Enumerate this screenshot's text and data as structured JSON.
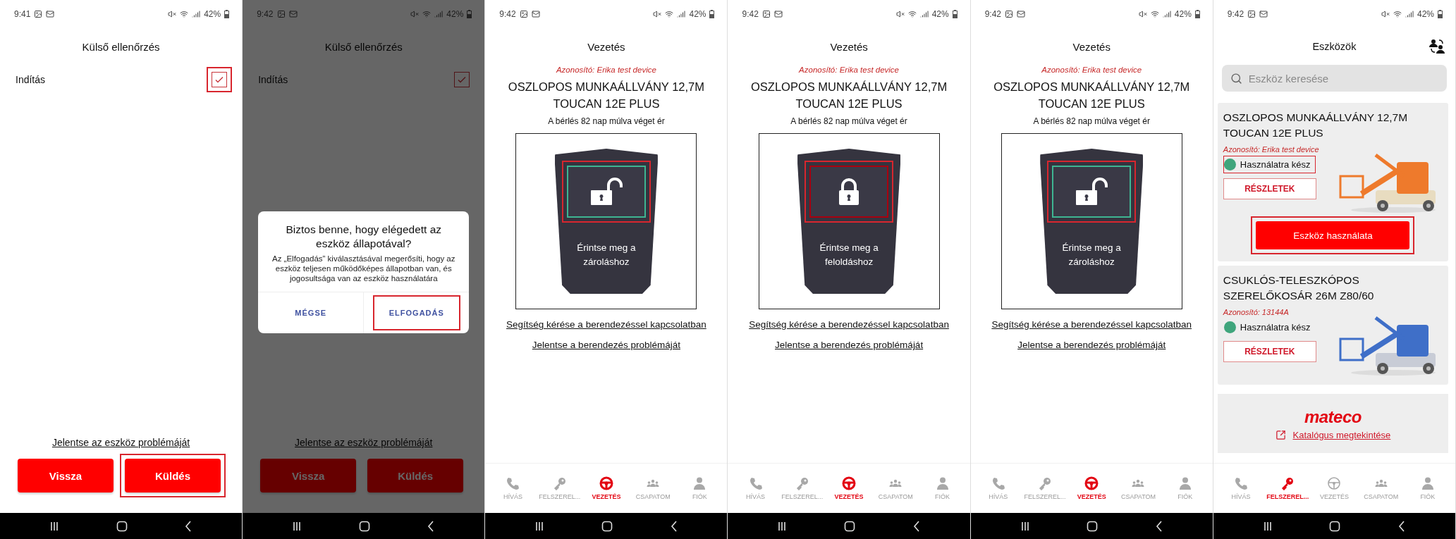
{
  "screens": [
    {
      "kind": "checklist",
      "time": "9:41",
      "battery": "42%",
      "dimmed": false,
      "title": "Külső ellenőrzés",
      "items": [
        {
          "label": "Indítás",
          "checked": true,
          "highlighted": true
        }
      ],
      "report_link": "Jelentse az eszköz problémáját",
      "buttons": [
        {
          "label": "Vissza",
          "highlighted": false
        },
        {
          "label": "Küldés",
          "highlighted": true
        }
      ]
    },
    {
      "kind": "checklist",
      "time": "9:42",
      "battery": "42%",
      "dimmed": true,
      "title": "Külső ellenőrzés",
      "items": [
        {
          "label": "Indítás",
          "checked": true,
          "highlighted": false
        }
      ],
      "report_link": "Jelentse az eszköz problémáját",
      "buttons": [
        {
          "label": "Vissza",
          "highlighted": false
        },
        {
          "label": "Küldés",
          "highlighted": false
        }
      ],
      "dialog": {
        "title": "Biztos benne, hogy elégedett az eszköz állapotával?",
        "body": "Az „Elfogadás” kiválasztásával megerősíti, hogy az eszköz teljesen működőképes állapotban van, és jogosultsága van az eszköz használatára",
        "buttons": [
          {
            "label": "MÉGSE",
            "highlighted": false
          },
          {
            "label": "ELFOGADÁS",
            "highlighted": true
          }
        ]
      }
    },
    {
      "kind": "drive",
      "time": "9:42",
      "battery": "42%",
      "title": "Vezetés",
      "device_id": "Azonosító: Erika test device",
      "device_name": "OSZLOPOS MUNKAÁLLVÁNY 12,7M TOUCAN 12E PLUS",
      "rental_note": "A bérlés 82 nap múlva véget ér",
      "lock": {
        "locked": false,
        "highlighted": true,
        "label": "Érintse meg a zároláshoz"
      },
      "links": [
        "Segítség kérése a berendezéssel kapcsolatban",
        "Jelentse a berendezés problémáját"
      ],
      "tabs": [
        {
          "label": "HÍVÁS",
          "selected": false
        },
        {
          "label": "FELSZEREL...",
          "selected": false
        },
        {
          "label": "VEZETÉS",
          "selected": true
        },
        {
          "label": "CSAPATOM",
          "selected": false
        },
        {
          "label": "FIÓK",
          "selected": false
        }
      ]
    },
    {
      "kind": "drive",
      "time": "9:42",
      "battery": "42%",
      "title": "Vezetés",
      "device_id": "Azonosító: Erika test device",
      "device_name": "OSZLOPOS MUNKAÁLLVÁNY 12,7M TOUCAN 12E PLUS",
      "rental_note": "A bérlés 82 nap múlva véget ér",
      "lock": {
        "locked": true,
        "highlighted": true,
        "label": "Érintse meg a feloldáshoz"
      },
      "links": [
        "Segítség kérése a berendezéssel kapcsolatban",
        "Jelentse a berendezés problémáját"
      ],
      "tabs": [
        {
          "label": "HÍVÁS",
          "selected": false
        },
        {
          "label": "FELSZEREL...",
          "selected": false
        },
        {
          "label": "VEZETÉS",
          "selected": true
        },
        {
          "label": "CSAPATOM",
          "selected": false
        },
        {
          "label": "FIÓK",
          "selected": false
        }
      ]
    },
    {
      "kind": "drive",
      "time": "9:42",
      "battery": "42%",
      "title": "Vezetés",
      "device_id": "Azonosító: Erika test device",
      "device_name": "OSZLOPOS MUNKAÁLLVÁNY 12,7M TOUCAN 12E PLUS",
      "rental_note": "A bérlés 82 nap múlva véget ér",
      "lock": {
        "locked": false,
        "highlighted": true,
        "label": "Érintse meg a zároláshoz"
      },
      "links": [
        "Segítség kérése a berendezéssel kapcsolatban",
        "Jelentse a berendezés problémáját"
      ],
      "tabs": [
        {
          "label": "HÍVÁS",
          "selected": false
        },
        {
          "label": "FELSZEREL...",
          "selected": false
        },
        {
          "label": "VEZETÉS",
          "selected": true
        },
        {
          "label": "CSAPATOM",
          "selected": false
        },
        {
          "label": "FIÓK",
          "selected": false
        }
      ]
    },
    {
      "kind": "devices",
      "time": "9:42",
      "battery": "42%",
      "title": "Eszközök",
      "search": {
        "placeholder": "Eszköz keresése"
      },
      "devices": [
        {
          "name": "OSZLOPOS MUNKAÁLLVÁNY 12,7M TOUCAN 12E PLUS",
          "device_id": "Azonosító: Erika test device",
          "status": "Használatra kész",
          "color": "#3fa57c",
          "status_highlighted": true,
          "details_button": "RÉSZLETEK",
          "use_button": "Eszköz használata",
          "use_highlighted": true
        },
        {
          "name": "CSUKLÓS-TELESZKÓPOS SZERELŐKOSÁR 26M Z80/60",
          "device_id": "Azonosító: 13144A",
          "status": "Használatra kész",
          "color": "#3fa57c",
          "status_highlighted": false,
          "details_button": "RÉSZLETEK"
        }
      ],
      "footer": {
        "logo": "mateco",
        "link": "Katalógus megtekintése"
      },
      "tabs": [
        {
          "label": "HÍVÁS",
          "selected": false
        },
        {
          "label": "FELSZEREL...",
          "selected": true
        },
        {
          "label": "VEZETÉS",
          "selected": false
        },
        {
          "label": "CSAPATOM",
          "selected": false
        },
        {
          "label": "FIÓK",
          "selected": false
        }
      ]
    }
  ]
}
